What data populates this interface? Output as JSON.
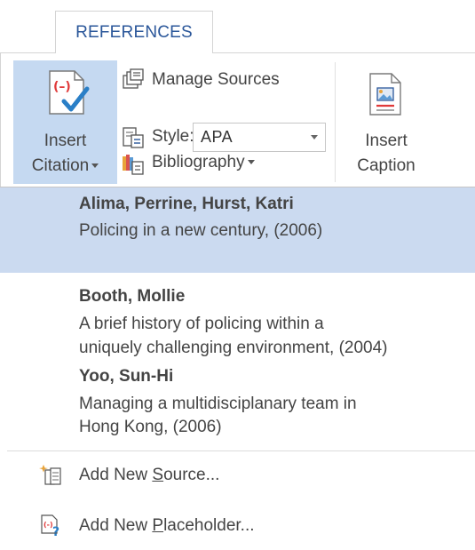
{
  "ribbon": {
    "tab_label": "REFERENCES",
    "insert_citation": {
      "label_line1": "Insert",
      "label_line2": "Citation"
    },
    "manage_sources_label": "Manage Sources",
    "style_label": "Style:",
    "style_value": "APA",
    "bibliography_label": "Bibliography",
    "insert_caption": {
      "label_line1": "Insert",
      "label_line2": "Caption"
    }
  },
  "menu": {
    "citations": [
      {
        "author": "Alima, Perrine,  Hurst, Katri",
        "title_lines": [
          "Policing in a new century, (2006)"
        ],
        "highlighted": true
      },
      {
        "author": "Booth, Mollie",
        "title_lines": [
          "A brief history of policing within a",
          "uniquely challenging environment, (2004)"
        ],
        "highlighted": false
      },
      {
        "author": "Yoo, Sun-Hi",
        "title_lines": [
          "Managing a multidisciplanary team in",
          "Hong Kong, (2006)"
        ],
        "highlighted": false
      }
    ],
    "commands": [
      {
        "label_prefix": "Add New ",
        "label_accel": "S",
        "label_suffix": "ource...",
        "icon": "add-source-icon"
      },
      {
        "label_prefix": "Add New ",
        "label_accel": "P",
        "label_suffix": "laceholder...",
        "icon": "add-placeholder-icon"
      }
    ]
  },
  "colors": {
    "accent": "#2b579a",
    "pressed_button": "#c5d9f1",
    "menu_highlight": "#cbdaf0",
    "citation_mark": "#e03a3a",
    "check_mark": "#2a7fc7"
  }
}
